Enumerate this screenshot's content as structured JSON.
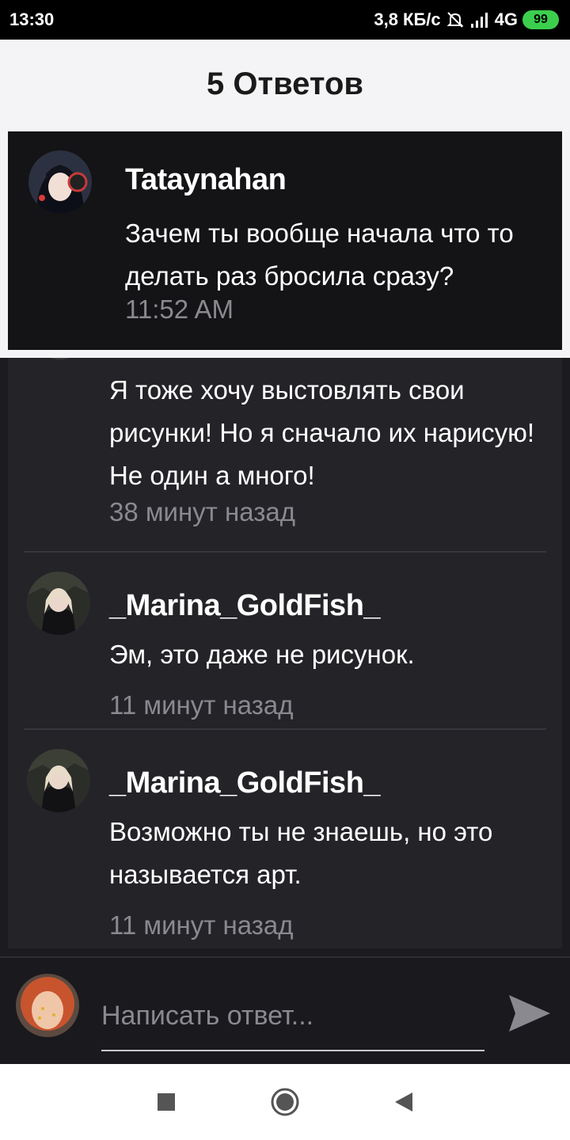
{
  "status_bar": {
    "time": "13:30",
    "speed": "3,8 КБ/с",
    "network": "4G",
    "battery": "99",
    "icons": [
      "mute-icon",
      "signal-icon",
      "battery-icon"
    ]
  },
  "header": {
    "title": "5 Ответов"
  },
  "parent_comment": {
    "author": "Tataynahan",
    "message": "Зачем ты вообще начала что то делать раз бросила сразу?",
    "time": "11:52 AM"
  },
  "replies": [
    {
      "author": "",
      "message": "Я тоже хочу выстовлять свои рисунки! Но я сначало их нарисую! Не один а много!",
      "time": "38 минут назад"
    },
    {
      "author": "_Marina_GoldFish_",
      "message": "Эм, это даже не рисунок.",
      "time": "11 минут назад"
    },
    {
      "author": "_Marina_GoldFish_",
      "message": "Возможно ты не знаешь, но это называется арт.",
      "time": "11 минут назад"
    }
  ],
  "composer": {
    "placeholder": "Написать ответ...",
    "value": ""
  },
  "nav_bar": {
    "icons": [
      "recent-apps-icon",
      "home-icon",
      "back-icon"
    ]
  },
  "colors": {
    "background": "#1c1b20",
    "card": "#242328",
    "header_bg": "#f4f4f6",
    "muted_text": "#8a898f",
    "battery": "#3ccf4e"
  }
}
